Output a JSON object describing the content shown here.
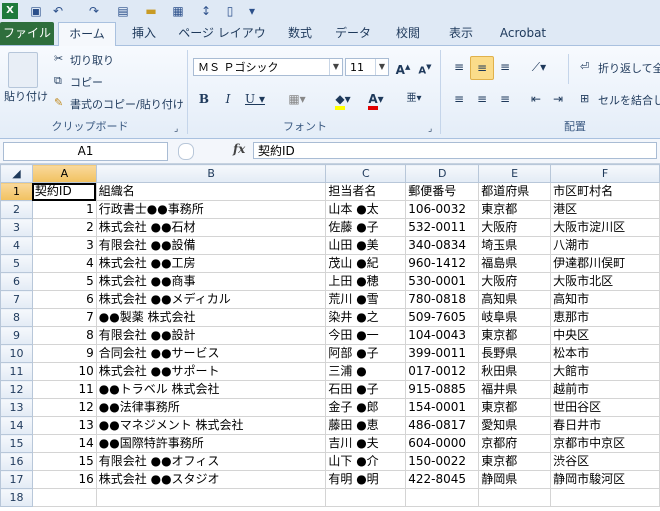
{
  "tabs": [
    "ファイル",
    "ホーム",
    "挿入",
    "ページ レイアウト",
    "数式",
    "データ",
    "校閲",
    "表示",
    "Acrobat"
  ],
  "ribbon": {
    "paste_label": "貼り付け",
    "cut_label": "切り取り",
    "copy_label": "コピー",
    "format_painter_label": "書式のコピー/貼り付け",
    "clipboard_group": "クリップボード",
    "font_name": "ＭＳ Ｐゴシック",
    "font_size": "11",
    "font_group": "フォント",
    "wrap_text_label": "折り返して全",
    "merge_label": "セルを結合し",
    "alignment_group": "配置"
  },
  "formula_bar": {
    "name_box": "A1",
    "fx_label": "fx",
    "formula": "契約ID"
  },
  "columns": [
    "A",
    "B",
    "C",
    "D",
    "E",
    "F"
  ],
  "rows": [
    [
      "契約ID",
      "組織名",
      "担当者名",
      "郵便番号",
      "都道府県",
      "市区町村名"
    ],
    [
      "1",
      "行政書士●●事務所",
      "山本 ●太",
      "106-0032",
      "東京都",
      "港区"
    ],
    [
      "2",
      "株式会社 ●●石材",
      "佐藤 ●子",
      "532-0011",
      "大阪府",
      "大阪市淀川区"
    ],
    [
      "3",
      "有限会社 ●●設備",
      "山田 ●美",
      "340-0834",
      "埼玉県",
      "八潮市"
    ],
    [
      "4",
      "株式会社 ●●工房",
      "茂山 ●紀",
      "960-1412",
      "福島県",
      "伊達郡川俣町"
    ],
    [
      "5",
      "株式会社 ●●商事",
      "上田 ●穂",
      "530-0001",
      "大阪府",
      "大阪市北区"
    ],
    [
      "6",
      "株式会社 ●●メディカル",
      "荒川 ●雪",
      "780-0818",
      "高知県",
      "高知市"
    ],
    [
      "7",
      "●●製薬 株式会社",
      "染井 ●之",
      "509-7605",
      "岐阜県",
      "恵那市"
    ],
    [
      "8",
      "有限会社 ●●設計",
      "今田 ●一",
      "104-0043",
      "東京都",
      "中央区"
    ],
    [
      "9",
      "合同会社 ●●サービス",
      "阿部 ●子",
      "399-0011",
      "長野県",
      "松本市"
    ],
    [
      "10",
      "株式会社 ●●サポート",
      "三浦 ●",
      "017-0012",
      "秋田県",
      "大館市"
    ],
    [
      "11",
      "●●トラベル 株式会社",
      "石田 ●子",
      "915-0885",
      "福井県",
      "越前市"
    ],
    [
      "12",
      "●●法律事務所",
      "金子 ●郎",
      "154-0001",
      "東京都",
      "世田谷区"
    ],
    [
      "13",
      "●●マネジメント 株式会社",
      "藤田 ●恵",
      "486-0817",
      "愛知県",
      "春日井市"
    ],
    [
      "14",
      "●●国際特許事務所",
      "吉川 ●夫",
      "604-0000",
      "京都府",
      "京都市中京区"
    ],
    [
      "15",
      "有限会社 ●●オフィス",
      "山下 ●介",
      "150-0022",
      "東京都",
      "渋谷区"
    ],
    [
      "16",
      "株式会社 ●●スタジオ",
      "有明 ●明",
      "422-8045",
      "静岡県",
      "静岡市駿河区"
    ],
    [
      "",
      "",
      "",
      "",
      "",
      ""
    ]
  ]
}
